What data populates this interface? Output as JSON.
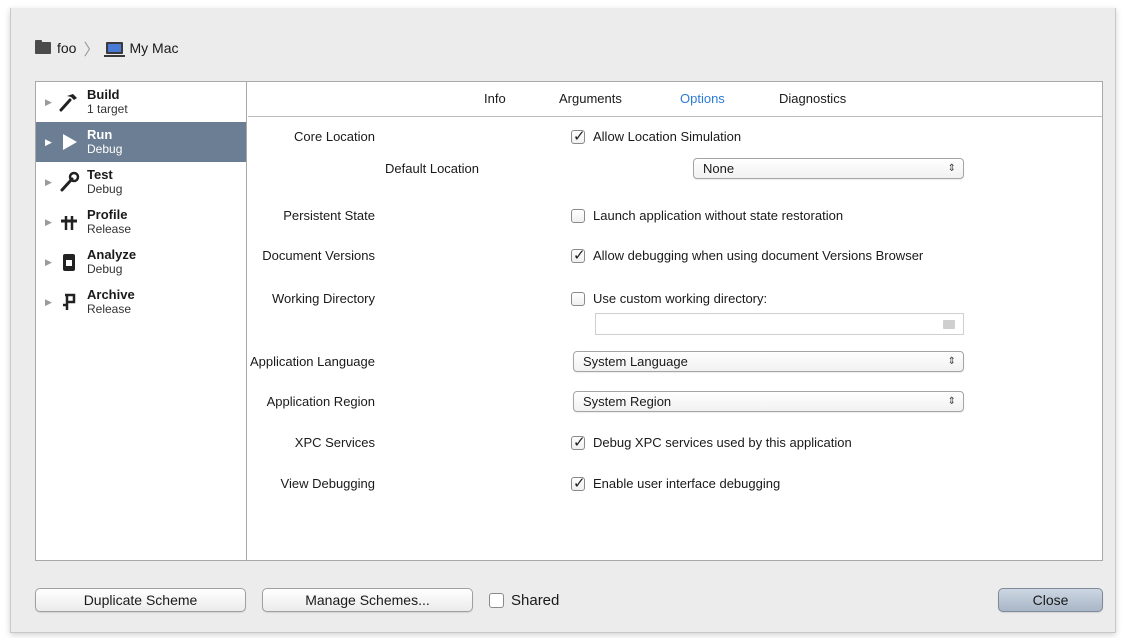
{
  "breadcrumb": {
    "project": "foo",
    "device": "My Mac"
  },
  "sidebar": {
    "items": [
      {
        "title": "Build",
        "sub": "1 target",
        "icon": "hammer-icon",
        "selected": false
      },
      {
        "title": "Run",
        "sub": "Debug",
        "icon": "play-icon",
        "selected": true
      },
      {
        "title": "Test",
        "sub": "Debug",
        "icon": "wrench-icon",
        "selected": false
      },
      {
        "title": "Profile",
        "sub": "Release",
        "icon": "profile-icon",
        "selected": false
      },
      {
        "title": "Analyze",
        "sub": "Debug",
        "icon": "analyze-icon",
        "selected": false
      },
      {
        "title": "Archive",
        "sub": "Release",
        "icon": "archive-icon",
        "selected": false
      }
    ]
  },
  "tabs": {
    "info": "Info",
    "arguments": "Arguments",
    "options": "Options",
    "diagnostics": "Diagnostics",
    "active": "Options",
    "active_color": "#2e7bd6"
  },
  "options": {
    "core_location": {
      "label": "Core Location",
      "checkbox": "Allow Location Simulation",
      "checked": true
    },
    "default_location": {
      "label": "Default Location",
      "value": "None"
    },
    "persistent_state": {
      "label": "Persistent State",
      "checkbox": "Launch application without state restoration",
      "checked": false
    },
    "document_versions": {
      "label": "Document Versions",
      "checkbox": "Allow debugging when using document Versions Browser",
      "checked": true
    },
    "working_directory": {
      "label": "Working Directory",
      "checkbox": "Use custom working directory:",
      "checked": false,
      "path": ""
    },
    "app_language": {
      "label": "Application Language",
      "value": "System Language"
    },
    "app_region": {
      "label": "Application Region",
      "value": "System Region"
    },
    "xpc_services": {
      "label": "XPC Services",
      "checkbox": "Debug XPC services used by this application",
      "checked": true
    },
    "view_debugging": {
      "label": "View Debugging",
      "checkbox": "Enable user interface debugging",
      "checked": true
    }
  },
  "footer": {
    "duplicate": "Duplicate Scheme",
    "manage": "Manage Schemes...",
    "shared": "Shared",
    "shared_checked": false,
    "close": "Close"
  }
}
